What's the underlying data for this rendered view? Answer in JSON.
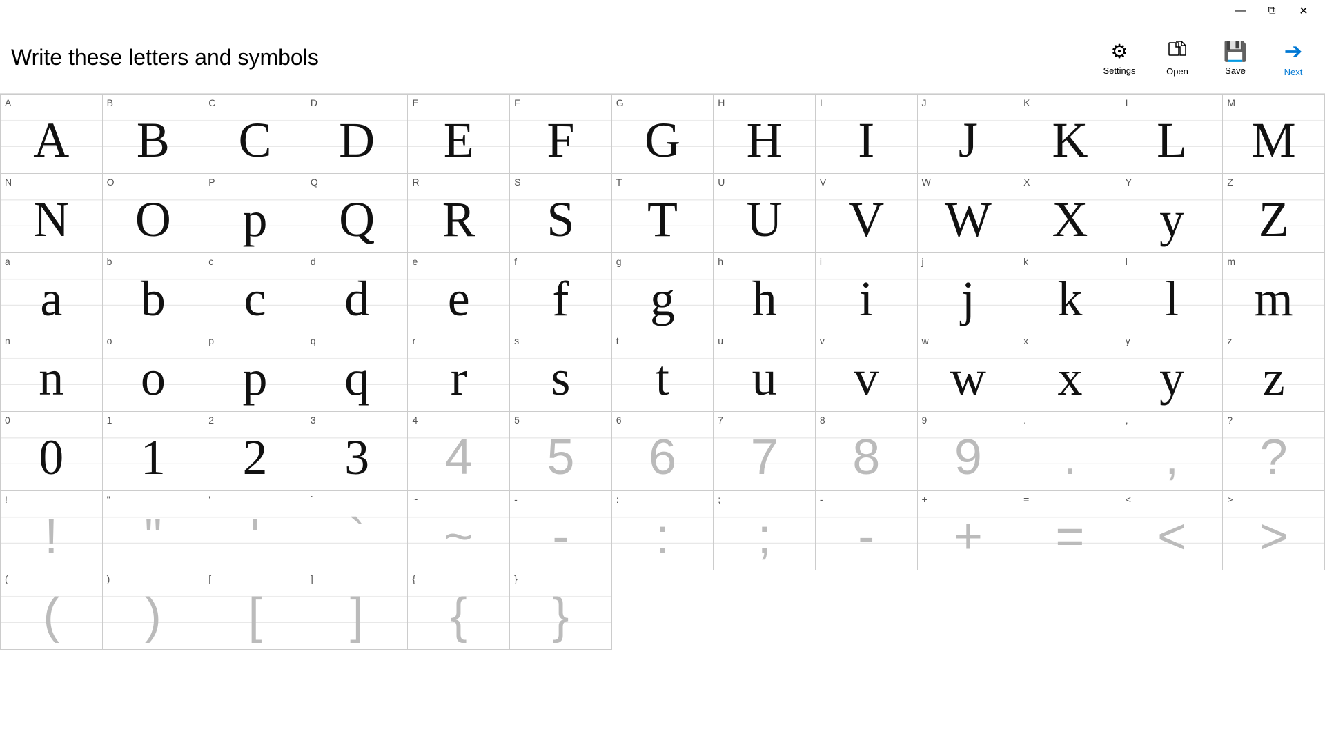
{
  "titlebar": {
    "minimize": "—",
    "maximize": "❐",
    "close": "✕"
  },
  "toolbar": {
    "title": "Write these letters and symbols",
    "actions": [
      {
        "id": "settings",
        "icon": "⚙",
        "label": "Settings"
      },
      {
        "id": "open",
        "icon": "📄",
        "label": "Open"
      },
      {
        "id": "save",
        "icon": "💾",
        "label": "Save"
      },
      {
        "id": "next",
        "icon": "→",
        "label": "Next"
      }
    ]
  },
  "cells": [
    {
      "label": "A",
      "char": "A",
      "style": "handwritten"
    },
    {
      "label": "B",
      "char": "B",
      "style": "handwritten"
    },
    {
      "label": "C",
      "char": "C",
      "style": "handwritten"
    },
    {
      "label": "D",
      "char": "D",
      "style": "handwritten"
    },
    {
      "label": "E",
      "char": "E",
      "style": "handwritten"
    },
    {
      "label": "F",
      "char": "F",
      "style": "handwritten"
    },
    {
      "label": "G",
      "char": "G",
      "style": "handwritten"
    },
    {
      "label": "H",
      "char": "H",
      "style": "handwritten"
    },
    {
      "label": "I",
      "char": "I",
      "style": "handwritten"
    },
    {
      "label": "J",
      "char": "J",
      "style": "handwritten"
    },
    {
      "label": "K",
      "char": "K",
      "style": "handwritten"
    },
    {
      "label": "L",
      "char": "L",
      "style": "handwritten"
    },
    {
      "label": "M",
      "char": "M",
      "style": "handwritten"
    },
    {
      "label": "N",
      "char": "N",
      "style": "handwritten"
    },
    {
      "label": "O",
      "char": "O",
      "style": "handwritten"
    },
    {
      "label": "P",
      "char": "p",
      "style": "handwritten"
    },
    {
      "label": "Q",
      "char": "Q",
      "style": "handwritten"
    },
    {
      "label": "R",
      "char": "R",
      "style": "handwritten"
    },
    {
      "label": "S",
      "char": "S",
      "style": "handwritten"
    },
    {
      "label": "T",
      "char": "T",
      "style": "handwritten"
    },
    {
      "label": "U",
      "char": "U",
      "style": "handwritten"
    },
    {
      "label": "V",
      "char": "V",
      "style": "handwritten"
    },
    {
      "label": "W",
      "char": "W",
      "style": "handwritten"
    },
    {
      "label": "X",
      "char": "X",
      "style": "handwritten"
    },
    {
      "label": "Y",
      "char": "y",
      "style": "handwritten"
    },
    {
      "label": "Z",
      "char": "Z",
      "style": "handwritten"
    },
    {
      "label": "a",
      "char": "a",
      "style": "handwritten"
    },
    {
      "label": "b",
      "char": "b",
      "style": "handwritten"
    },
    {
      "label": "c",
      "char": "c",
      "style": "handwritten"
    },
    {
      "label": "d",
      "char": "d",
      "style": "handwritten"
    },
    {
      "label": "e",
      "char": "e",
      "style": "handwritten"
    },
    {
      "label": "f",
      "char": "f",
      "style": "handwritten"
    },
    {
      "label": "g",
      "char": "g",
      "style": "handwritten"
    },
    {
      "label": "h",
      "char": "h",
      "style": "handwritten"
    },
    {
      "label": "i",
      "char": "i",
      "style": "handwritten"
    },
    {
      "label": "j",
      "char": "j",
      "style": "handwritten"
    },
    {
      "label": "k",
      "char": "k",
      "style": "handwritten"
    },
    {
      "label": "l",
      "char": "l",
      "style": "handwritten"
    },
    {
      "label": "m",
      "char": "m",
      "style": "handwritten"
    },
    {
      "label": "n",
      "char": "n",
      "style": "handwritten"
    },
    {
      "label": "o",
      "char": "o",
      "style": "handwritten"
    },
    {
      "label": "p",
      "char": "p",
      "style": "handwritten"
    },
    {
      "label": "q",
      "char": "q",
      "style": "handwritten"
    },
    {
      "label": "r",
      "char": "r",
      "style": "handwritten"
    },
    {
      "label": "s",
      "char": "s",
      "style": "handwritten"
    },
    {
      "label": "t",
      "char": "t",
      "style": "handwritten"
    },
    {
      "label": "u",
      "char": "u",
      "style": "handwritten"
    },
    {
      "label": "v",
      "char": "v",
      "style": "handwritten"
    },
    {
      "label": "w",
      "char": "w",
      "style": "handwritten"
    },
    {
      "label": "x",
      "char": "x",
      "style": "handwritten"
    },
    {
      "label": "y",
      "char": "y",
      "style": "handwritten"
    },
    {
      "label": "z",
      "char": "z",
      "style": "handwritten"
    },
    {
      "label": "0",
      "char": "0",
      "style": "handwritten"
    },
    {
      "label": "1",
      "char": "1",
      "style": "handwritten"
    },
    {
      "label": "2",
      "char": "2",
      "style": "handwritten"
    },
    {
      "label": "3",
      "char": "3",
      "style": "handwritten"
    },
    {
      "label": "4",
      "char": "4",
      "style": "placeholder"
    },
    {
      "label": "5",
      "char": "5",
      "style": "placeholder"
    },
    {
      "label": "6",
      "char": "6",
      "style": "placeholder"
    },
    {
      "label": "7",
      "char": "7",
      "style": "placeholder"
    },
    {
      "label": "8",
      "char": "8",
      "style": "placeholder"
    },
    {
      "label": "9",
      "char": "9",
      "style": "placeholder"
    },
    {
      "label": ".",
      "char": ".",
      "style": "placeholder"
    },
    {
      "label": ",",
      "char": ",",
      "style": "placeholder"
    },
    {
      "label": "?",
      "char": "?",
      "style": "placeholder"
    },
    {
      "label": "!",
      "char": "!",
      "style": "placeholder"
    },
    {
      "label": "\"",
      "char": "\"",
      "style": "placeholder"
    },
    {
      "label": "'",
      "char": "'",
      "style": "placeholder"
    },
    {
      "label": "`",
      "char": "`",
      "style": "placeholder"
    },
    {
      "label": "~",
      "char": "~",
      "style": "placeholder"
    },
    {
      "label": "-",
      "char": "-",
      "style": "placeholder"
    },
    {
      "label": ":",
      "char": ":",
      "style": "placeholder"
    },
    {
      "label": ";",
      "char": ";",
      "style": "placeholder"
    },
    {
      "label": "-",
      "char": "-",
      "style": "placeholder"
    },
    {
      "label": "+",
      "char": "+",
      "style": "placeholder"
    },
    {
      "label": "=",
      "char": "=",
      "style": "placeholder"
    },
    {
      "label": "<",
      "char": "<",
      "style": "placeholder"
    },
    {
      "label": ">",
      "char": ">",
      "style": "placeholder"
    },
    {
      "label": "(",
      "char": "(",
      "style": "placeholder"
    },
    {
      "label": ")",
      "char": ")",
      "style": "placeholder"
    },
    {
      "label": "[",
      "char": "[",
      "style": "placeholder"
    },
    {
      "label": "]",
      "char": "]",
      "style": "placeholder"
    },
    {
      "label": "{",
      "char": "{",
      "style": "placeholder"
    },
    {
      "label": "}",
      "char": "}",
      "style": "placeholder"
    }
  ]
}
